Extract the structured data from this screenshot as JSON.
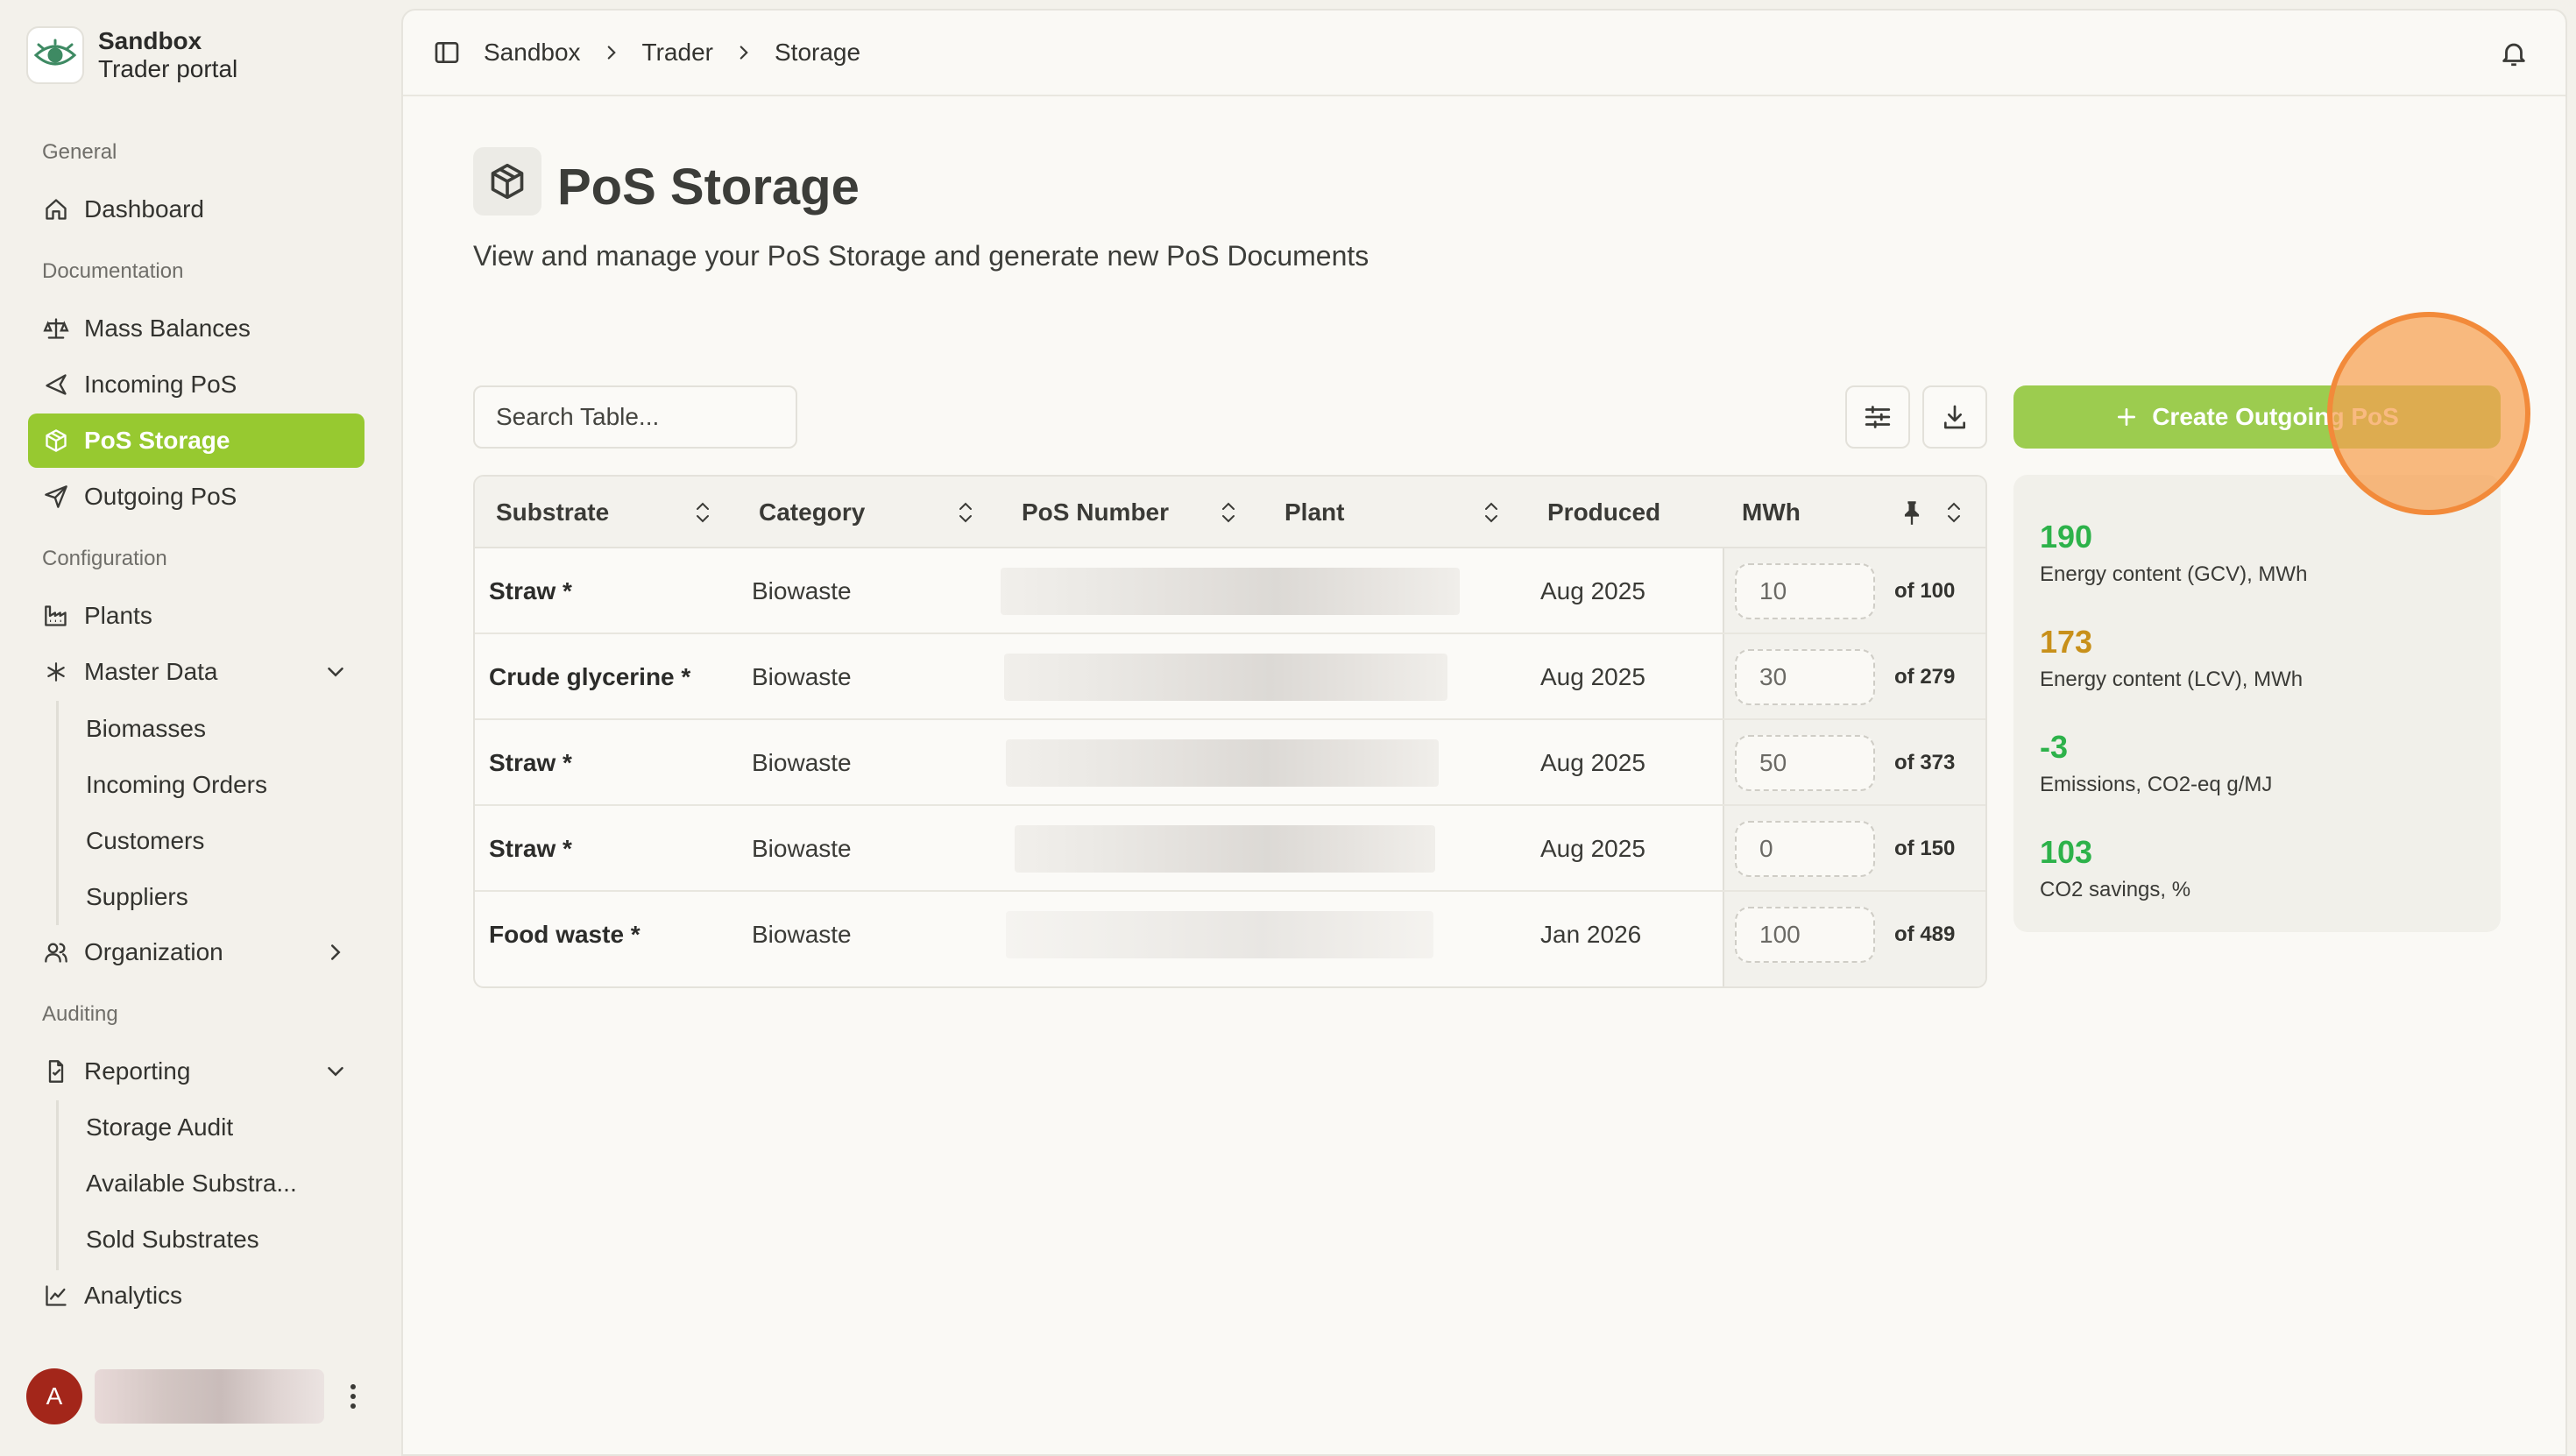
{
  "brand": {
    "name": "Sandbox",
    "subtitle": "Trader portal"
  },
  "sidebar": {
    "groups": {
      "general": "General",
      "documentation": "Documentation",
      "configuration": "Configuration",
      "auditing": "Auditing"
    },
    "items": {
      "dashboard": "Dashboard",
      "mass_balances": "Mass Balances",
      "incoming_pos": "Incoming PoS",
      "pos_storage": "PoS Storage",
      "outgoing_pos": "Outgoing PoS",
      "plants": "Plants",
      "master_data": "Master Data",
      "organization": "Organization",
      "reporting": "Reporting",
      "analytics": "Analytics"
    },
    "master_data_children": [
      "Biomasses",
      "Incoming Orders",
      "Customers",
      "Suppliers"
    ],
    "reporting_children": [
      "Storage Audit",
      "Available Substra...",
      "Sold Substrates"
    ],
    "active_item": "pos_storage",
    "accent_color": "#97c930"
  },
  "user": {
    "initial": "A",
    "name": "",
    "avatar_color": "#a3261a"
  },
  "breadcrumb": [
    "Sandbox",
    "Trader",
    "Storage"
  ],
  "page": {
    "title": "PoS Storage",
    "subtitle": "View and manage your PoS Storage and generate new PoS Documents"
  },
  "toolbar": {
    "search_placeholder": "Search Table...",
    "create_button_label": "Create Outgoing PoS"
  },
  "table": {
    "columns": [
      "Substrate",
      "Category",
      "PoS Number",
      "Plant",
      "Produced",
      "MWh"
    ],
    "rows": [
      {
        "substrate": "Straw *",
        "category": "Biowaste",
        "pos_number": "",
        "plant": "",
        "produced": "Aug 2025",
        "mwh": "10",
        "of_total": "of 100"
      },
      {
        "substrate": "Crude glycerine *",
        "category": "Biowaste",
        "pos_number": "",
        "plant": "",
        "produced": "Aug 2025",
        "mwh": "30",
        "of_total": "of 279"
      },
      {
        "substrate": "Straw *",
        "category": "Biowaste",
        "pos_number": "",
        "plant": "",
        "produced": "Aug 2025",
        "mwh": "50",
        "of_total": "of 373"
      },
      {
        "substrate": "Straw *",
        "category": "Biowaste",
        "pos_number": "",
        "plant": "",
        "produced": "Aug 2025",
        "mwh": "0",
        "of_total": "of 150"
      },
      {
        "substrate": "Food waste *",
        "category": "Biowaste",
        "pos_number": "",
        "plant": "",
        "produced": "Jan 2026",
        "mwh": "100",
        "of_total": "of 489"
      }
    ]
  },
  "stats": [
    {
      "value": "190",
      "label": "Energy content (GCV), MWh",
      "color": "#2db24a"
    },
    {
      "value": "173",
      "label": "Energy content (LCV), MWh",
      "color": "#c8901a"
    },
    {
      "value": "-3",
      "label": "Emissions, CO2-eq g/MJ",
      "color": "#2db24a"
    },
    {
      "value": "103",
      "label": "CO2 savings, %",
      "color": "#2db24a"
    }
  ]
}
